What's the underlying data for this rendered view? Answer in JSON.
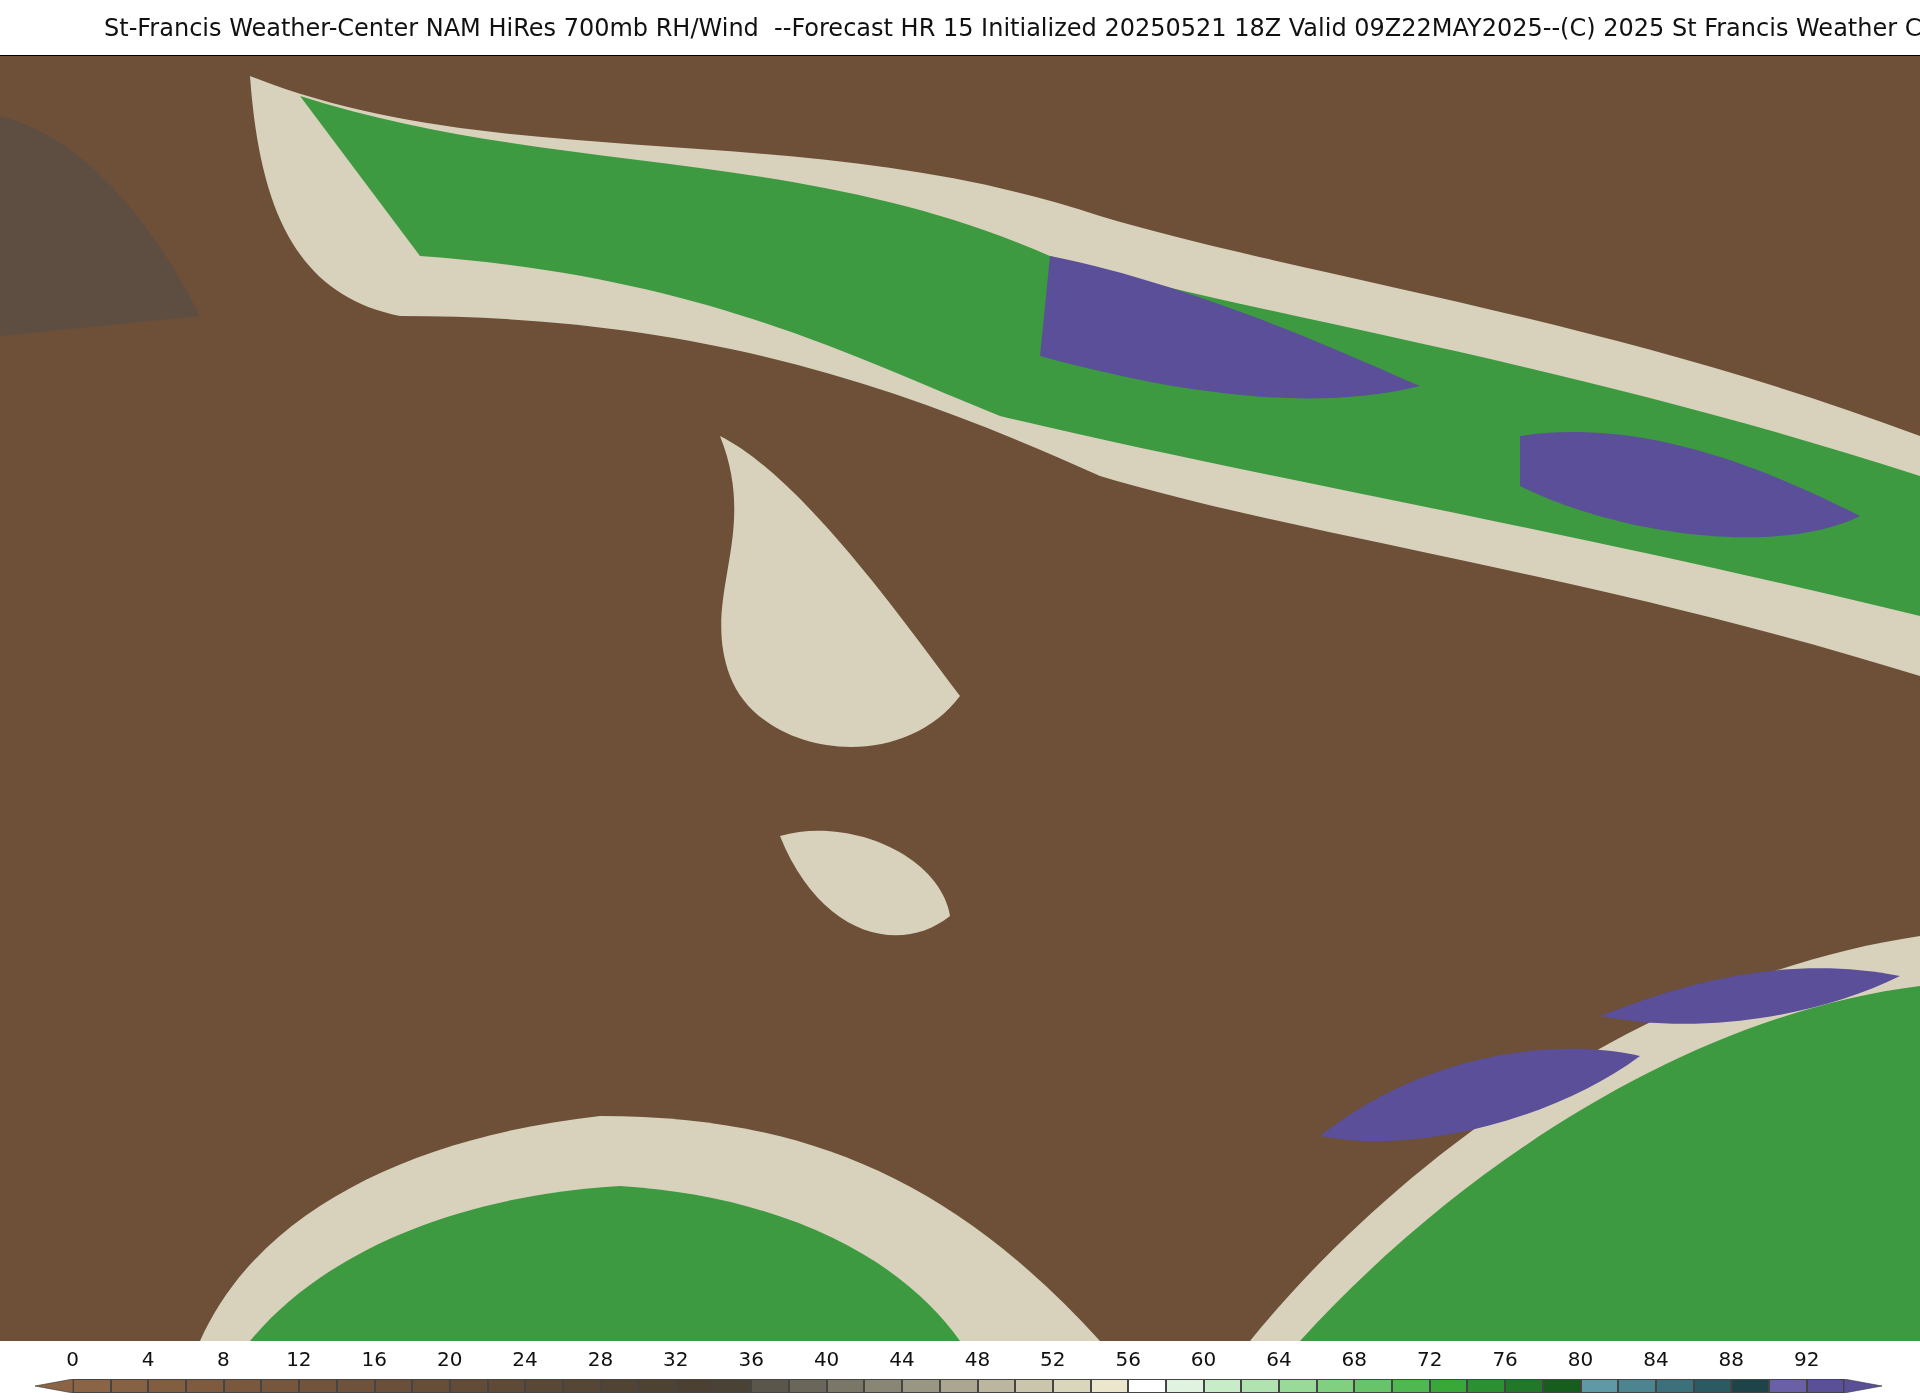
{
  "title": "St-Francis Weather-Center NAM HiRes 700mb RH/Wind  --Forecast HR 15 Initialized 20250521 18Z Valid 09Z22MAY2025--(C) 2025 St Francis Weather C",
  "colorbar": {
    "ticks": [
      "0",
      "4",
      "8",
      "12",
      "16",
      "20",
      "24",
      "28",
      "32",
      "36",
      "40",
      "44",
      "48",
      "52",
      "56",
      "60",
      "64",
      "68",
      "72",
      "76",
      "80",
      "84",
      "88",
      "92"
    ],
    "segments": [
      {
        "color": "#8a6445"
      },
      {
        "color": "#866143"
      },
      {
        "color": "#825e41"
      },
      {
        "color": "#7e5b3f"
      },
      {
        "color": "#7a583e"
      },
      {
        "color": "#76563d"
      },
      {
        "color": "#72543c"
      },
      {
        "color": "#6e523b"
      },
      {
        "color": "#6a503a"
      },
      {
        "color": "#664e39"
      },
      {
        "color": "#624c38"
      },
      {
        "color": "#5e4a37"
      },
      {
        "color": "#5a4836"
      },
      {
        "color": "#564635"
      },
      {
        "color": "#524434"
      },
      {
        "color": "#4e4233"
      },
      {
        "color": "#4b4032"
      },
      {
        "color": "#4a4235"
      },
      {
        "color": "#5a564c"
      },
      {
        "color": "#6a665a"
      },
      {
        "color": "#7a7668"
      },
      {
        "color": "#8a8676"
      },
      {
        "color": "#9a9684"
      },
      {
        "color": "#aaa692"
      },
      {
        "color": "#bab6a0"
      },
      {
        "color": "#cac6ae"
      },
      {
        "color": "#dad6bc"
      },
      {
        "color": "#ebe6cc"
      },
      {
        "color": "#ffffff"
      },
      {
        "color": "#e0f2e0"
      },
      {
        "color": "#c8ebc8"
      },
      {
        "color": "#b0e3b0"
      },
      {
        "color": "#98db98"
      },
      {
        "color": "#80d080"
      },
      {
        "color": "#68c468"
      },
      {
        "color": "#50b850"
      },
      {
        "color": "#38a838"
      },
      {
        "color": "#2a9030"
      },
      {
        "color": "#207828"
      },
      {
        "color": "#165e1e"
      },
      {
        "color": "#5e9aa6"
      },
      {
        "color": "#4c8590"
      },
      {
        "color": "#3c707a"
      },
      {
        "color": "#2c5a62"
      },
      {
        "color": "#1e444a"
      },
      {
        "color": "#6a60a8"
      },
      {
        "color": "#5a5098"
      }
    ]
  }
}
